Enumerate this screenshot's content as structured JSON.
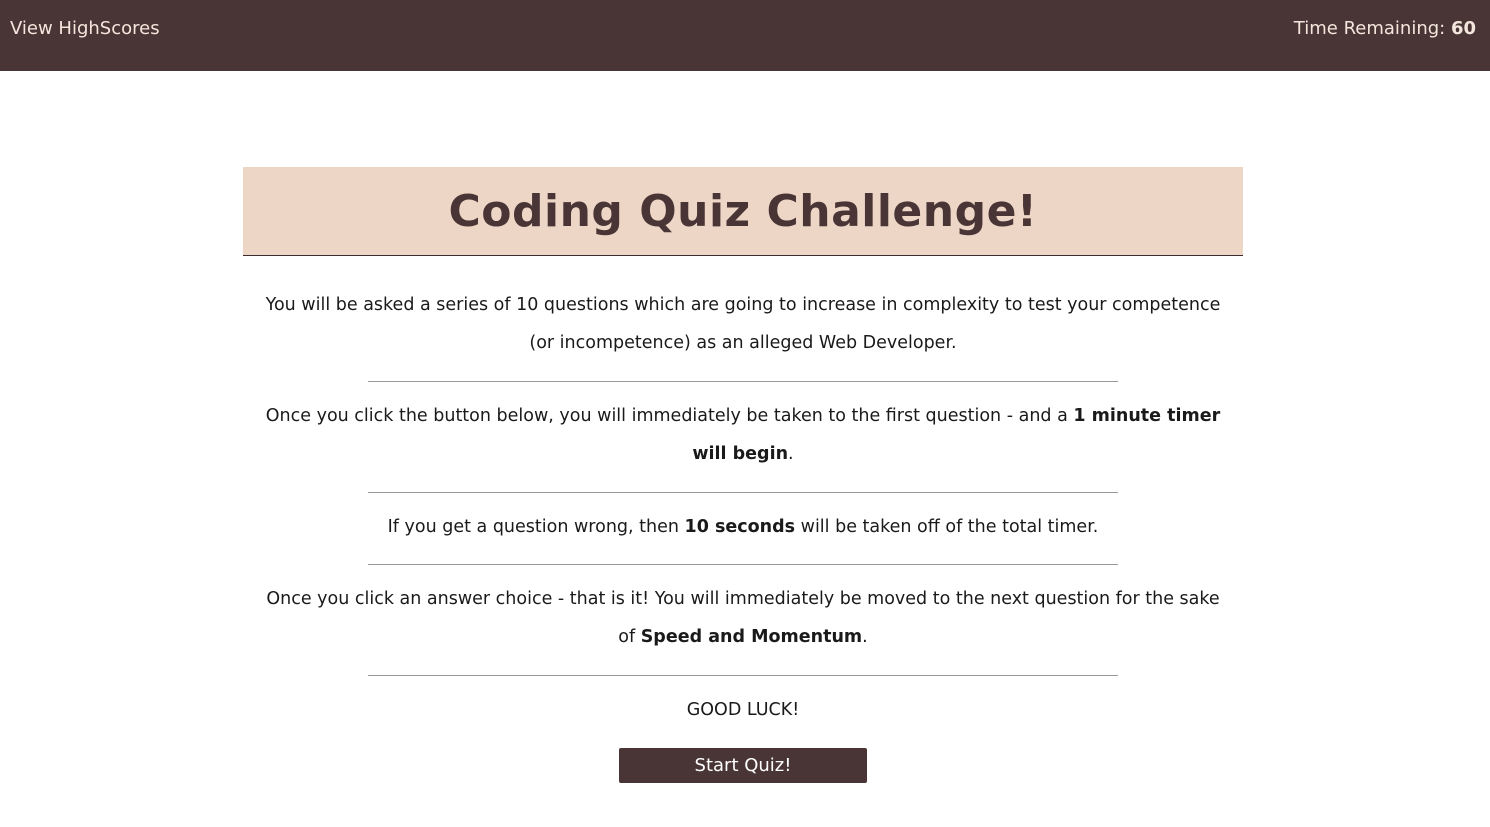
{
  "header": {
    "highscores_label": "View HighScores",
    "timer_label": "Time Remaining: ",
    "timer_value": "60"
  },
  "main": {
    "title": "Coding Quiz Challenge!",
    "intro": {
      "line1": "You will be asked a series of 10 questions which are going to increase in complexity to test your competence",
      "line2": "(or incompetence) as an alleged Web Developer."
    },
    "timer_info": {
      "before": "Once you click the button below, you will immediately be taken to the first question - and a ",
      "bold_a": "1 minute timer",
      "bold_b": "will begin",
      "after": "."
    },
    "penalty_info": {
      "before": "If you get a question wrong, then ",
      "bold": "10 seconds",
      "after": " will be taken off of the total timer."
    },
    "answer_info": {
      "line1": "Once you click an answer choice - that is it! You will immediately be moved to the next question for the sake",
      "before": "of ",
      "bold": "Speed and Momentum",
      "after": "."
    },
    "good_luck": "GOOD LUCK!",
    "start_button": "Start Quiz!"
  },
  "colors": {
    "header_bg": "#4a3536",
    "title_bg": "#eed6c6",
    "button_bg": "#4a3536"
  }
}
